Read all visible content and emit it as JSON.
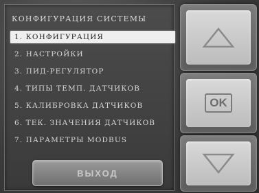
{
  "menu": {
    "title": "КОНФИГУРАЦИЯ СИСТЕМЫ",
    "items": [
      {
        "label": "1. КОНФИГУРАЦИЯ",
        "selected": true
      },
      {
        "label": "2. НАСТРОЙКИ",
        "selected": false
      },
      {
        "label": "3. ПИД-РЕГУЛЯТОР",
        "selected": false
      },
      {
        "label": "4. ТИПЫ ТЕМП. ДАТЧИКОВ",
        "selected": false
      },
      {
        "label": "5. КАЛИБРОВКА ДАТЧИКОВ",
        "selected": false
      },
      {
        "label": "6. ТЕК. ЗНАЧЕНИЯ ДАТЧИКОВ",
        "selected": false
      },
      {
        "label": "7. ПАРАМЕТРЫ MODBUS",
        "selected": false
      }
    ],
    "exit_label": "ВЫХОД"
  },
  "buttons": {
    "up_icon": "up-arrow-icon",
    "ok_label": "OK",
    "down_icon": "down-arrow-icon"
  },
  "colors": {
    "background": "#3f3f3f",
    "selected_bg": "#efefef",
    "button_face": "#cfcfcf"
  }
}
